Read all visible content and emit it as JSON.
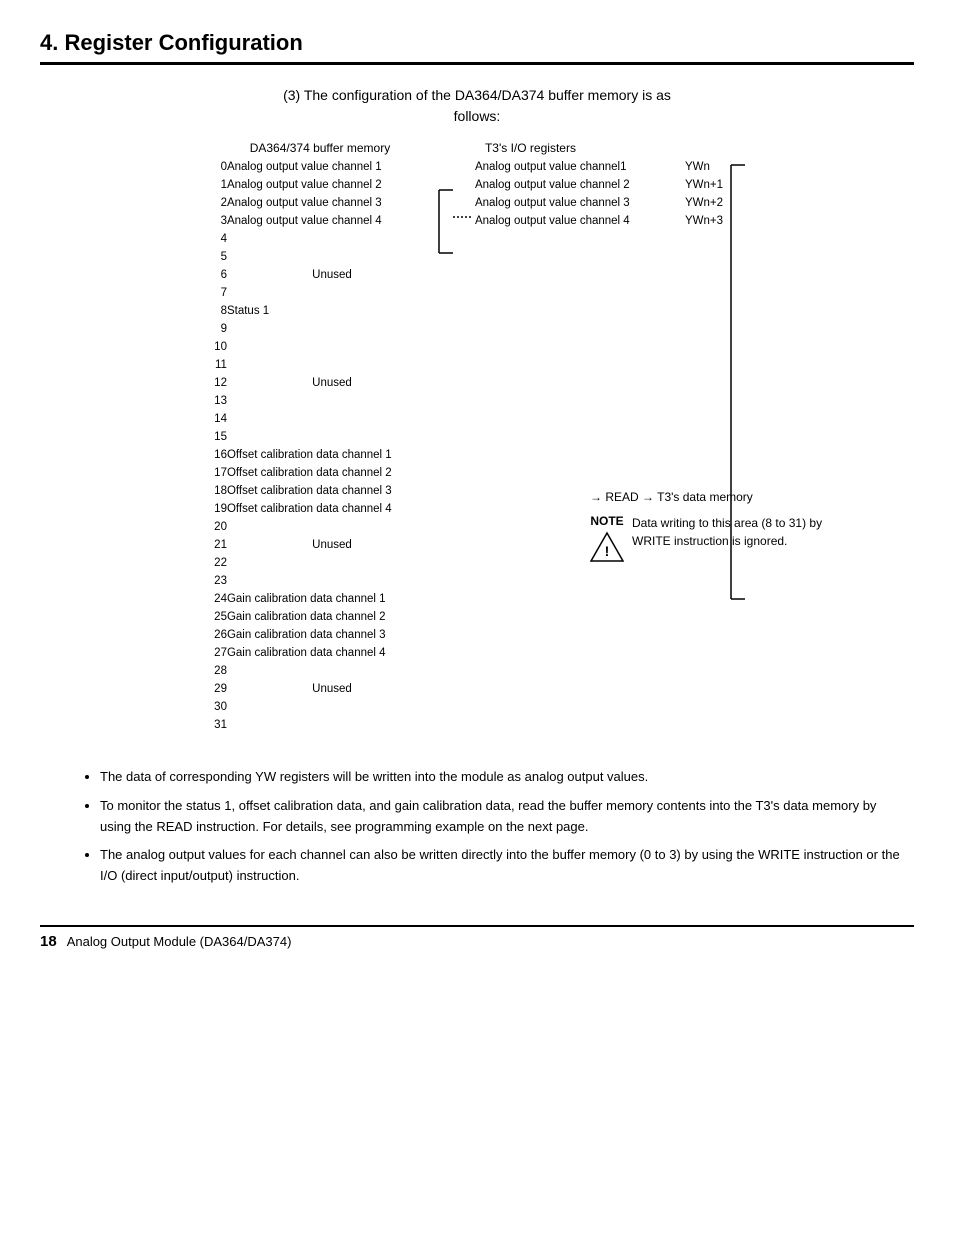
{
  "page": {
    "title": "4.  Register Configuration",
    "footer_num": "18",
    "footer_title": "Analog Output Module (DA364/DA374)"
  },
  "section": {
    "subtitle_line1": "(3) The configuration of the DA364/DA374 buffer memory is as",
    "subtitle_line2": "follows:"
  },
  "buffer_memory": {
    "label": "DA364/374 buffer memory",
    "rows": [
      {
        "num": "0",
        "cell": "Analog output value channel 1",
        "type": "data"
      },
      {
        "num": "1",
        "cell": "Analog output value channel 2",
        "type": "data"
      },
      {
        "num": "2",
        "cell": "Analog output value channel 3",
        "type": "data"
      },
      {
        "num": "3",
        "cell": "Analog output value channel 4",
        "type": "data"
      },
      {
        "num": "4",
        "cell": "",
        "type": "unused_top"
      },
      {
        "num": "5",
        "cell": "",
        "type": "unused_mid"
      },
      {
        "num": "6",
        "cell": "Unused",
        "type": "unused_label"
      },
      {
        "num": "7",
        "cell": "",
        "type": "unused_bot"
      },
      {
        "num": "8",
        "cell": "Status 1",
        "type": "data"
      },
      {
        "num": "9",
        "cell": "",
        "type": "unused_top2"
      },
      {
        "num": "10",
        "cell": "",
        "type": "unused_mid2"
      },
      {
        "num": "11",
        "cell": "",
        "type": "unused_mid2"
      },
      {
        "num": "12",
        "cell": "Unused",
        "type": "unused_label2"
      },
      {
        "num": "13",
        "cell": "",
        "type": "unused_mid2"
      },
      {
        "num": "14",
        "cell": "",
        "type": "unused_mid2"
      },
      {
        "num": "15",
        "cell": "",
        "type": "unused_bot2"
      },
      {
        "num": "16",
        "cell": "Offset calibration data channel 1",
        "type": "data"
      },
      {
        "num": "17",
        "cell": "Offset calibration data channel 2",
        "type": "data"
      },
      {
        "num": "18",
        "cell": "Offset calibration data channel 3",
        "type": "data"
      },
      {
        "num": "19",
        "cell": "Offset calibration data channel 4",
        "type": "data"
      },
      {
        "num": "20",
        "cell": "",
        "type": "unused_top3"
      },
      {
        "num": "21",
        "cell": "",
        "type": "unused_mid3"
      },
      {
        "num": "22",
        "cell": "Unused",
        "type": "unused_label3"
      },
      {
        "num": "23",
        "cell": "",
        "type": "unused_bot3"
      },
      {
        "num": "24",
        "cell": "Gain calibration data channel 1",
        "type": "data"
      },
      {
        "num": "25",
        "cell": "Gain calibration data channel 2",
        "type": "data"
      },
      {
        "num": "26",
        "cell": "Gain calibration data channel 3",
        "type": "data"
      },
      {
        "num": "27",
        "cell": "Gain calibration data channel 4",
        "type": "data"
      },
      {
        "num": "28",
        "cell": "",
        "type": "unused_top4"
      },
      {
        "num": "29",
        "cell": "",
        "type": "unused_mid4"
      },
      {
        "num": "30",
        "cell": "Unused",
        "type": "unused_label4"
      },
      {
        "num": "31",
        "cell": "",
        "type": "unused_bot4"
      }
    ]
  },
  "io_registers": {
    "label": "T3's I/O registers",
    "rows": [
      {
        "cell": "Analog output value channel1",
        "label": "YWn"
      },
      {
        "cell": "Analog output value channel 2",
        "label": "YWn+1"
      },
      {
        "cell": "Analog output value channel 3",
        "label": "YWn+2"
      },
      {
        "cell": "Analog output value channel 4",
        "label": "YWn+3"
      }
    ]
  },
  "note": {
    "label": "NOTE",
    "text": "Data writing to this area (8 to 31) by WRITE instruction is ignored."
  },
  "read_arrow": "→ READ → T3's data memory",
  "bullets": [
    "The data of corresponding YW registers will be  written into the module as analog output values.",
    "To monitor the status 1, offset calibration data, and gain calibration data, read the buffer memory contents into the T3's data memory by using the READ instruction. For details, see programming example on the next page.",
    "The analog output values for each channel can also be written directly into the buffer memory (0 to 3) by using the WRITE instruction or the I/O (direct input/output) instruction."
  ]
}
